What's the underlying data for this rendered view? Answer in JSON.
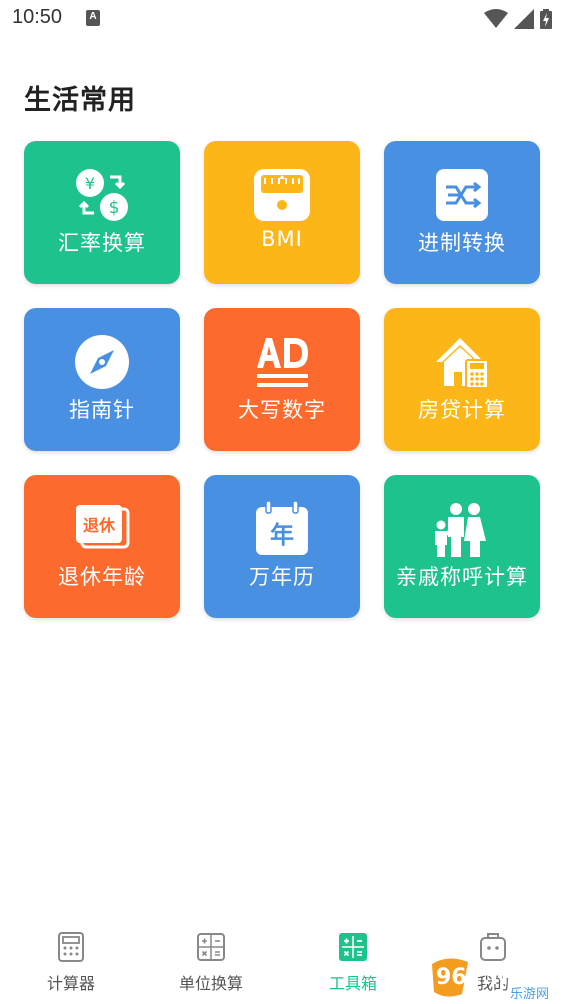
{
  "status_bar": {
    "time": "10:50",
    "notification_icon": "A"
  },
  "section": {
    "title": "生活常用"
  },
  "tools": [
    {
      "label": "汇率换算",
      "icon": "currency-exchange-icon",
      "color": "#1dc28f"
    },
    {
      "label": "BMI",
      "icon": "scale-icon",
      "color": "#fcb617"
    },
    {
      "label": "进制转换",
      "icon": "base-convert-icon",
      "color": "#4a90e2"
    },
    {
      "label": "指南针",
      "icon": "compass-icon",
      "color": "#4a90e2"
    },
    {
      "label": "大写数字",
      "icon": "capital-number-icon",
      "color": "#fc6b2d"
    },
    {
      "label": "房贷计算",
      "icon": "mortgage-icon",
      "color": "#fcb617"
    },
    {
      "label": "退休年龄",
      "icon": "retire-icon",
      "color": "#fc6b2d",
      "icon_text": "退休"
    },
    {
      "label": "万年历",
      "icon": "calendar-icon",
      "color": "#4a90e2",
      "icon_text": "年"
    },
    {
      "label": "亲戚称呼计算",
      "icon": "family-icon",
      "color": "#1dc28f"
    }
  ],
  "bottom_nav": {
    "items": [
      {
        "label": "计算器",
        "icon": "calculator-icon"
      },
      {
        "label": "单位换算",
        "icon": "unit-convert-icon"
      },
      {
        "label": "工具箱",
        "icon": "toolbox-icon",
        "active": true
      },
      {
        "label": "我的",
        "icon": "profile-icon"
      }
    ],
    "active_color": "#1ec28b"
  },
  "watermark": {
    "text": "962.NET",
    "sub": "乐游网"
  }
}
